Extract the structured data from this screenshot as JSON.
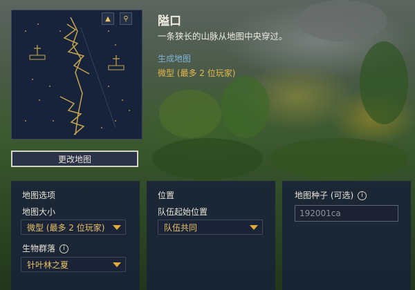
{
  "map": {
    "title": "隘口",
    "description": "一条狭长的山脉从地图中央穿过。",
    "generate_label": "生成地图",
    "generate_value": "微型 (最多 2 位玩家)",
    "change_button": "更改地图",
    "minimap_buttons": [
      {
        "icon": "mountain-icon",
        "glyph": "▲"
      },
      {
        "icon": "river-icon",
        "glyph": "⚲"
      }
    ]
  },
  "panels": {
    "map_options": {
      "title": "地图选项",
      "size_label": "地图大小",
      "size_value": "微型 (最多 2 位玩家)",
      "biome_label": "生物群落",
      "biome_value": "针叶林之夏"
    },
    "position": {
      "title": "位置",
      "start_label": "队伍起始位置",
      "start_value": "队伍共同"
    },
    "seed": {
      "title": "地图种子 (可选)",
      "placeholder": "192001ca"
    }
  },
  "colors": {
    "accent_gold": "#e8c16a",
    "link_blue": "#7fb4d6",
    "panel_bg": "#1a2436"
  }
}
